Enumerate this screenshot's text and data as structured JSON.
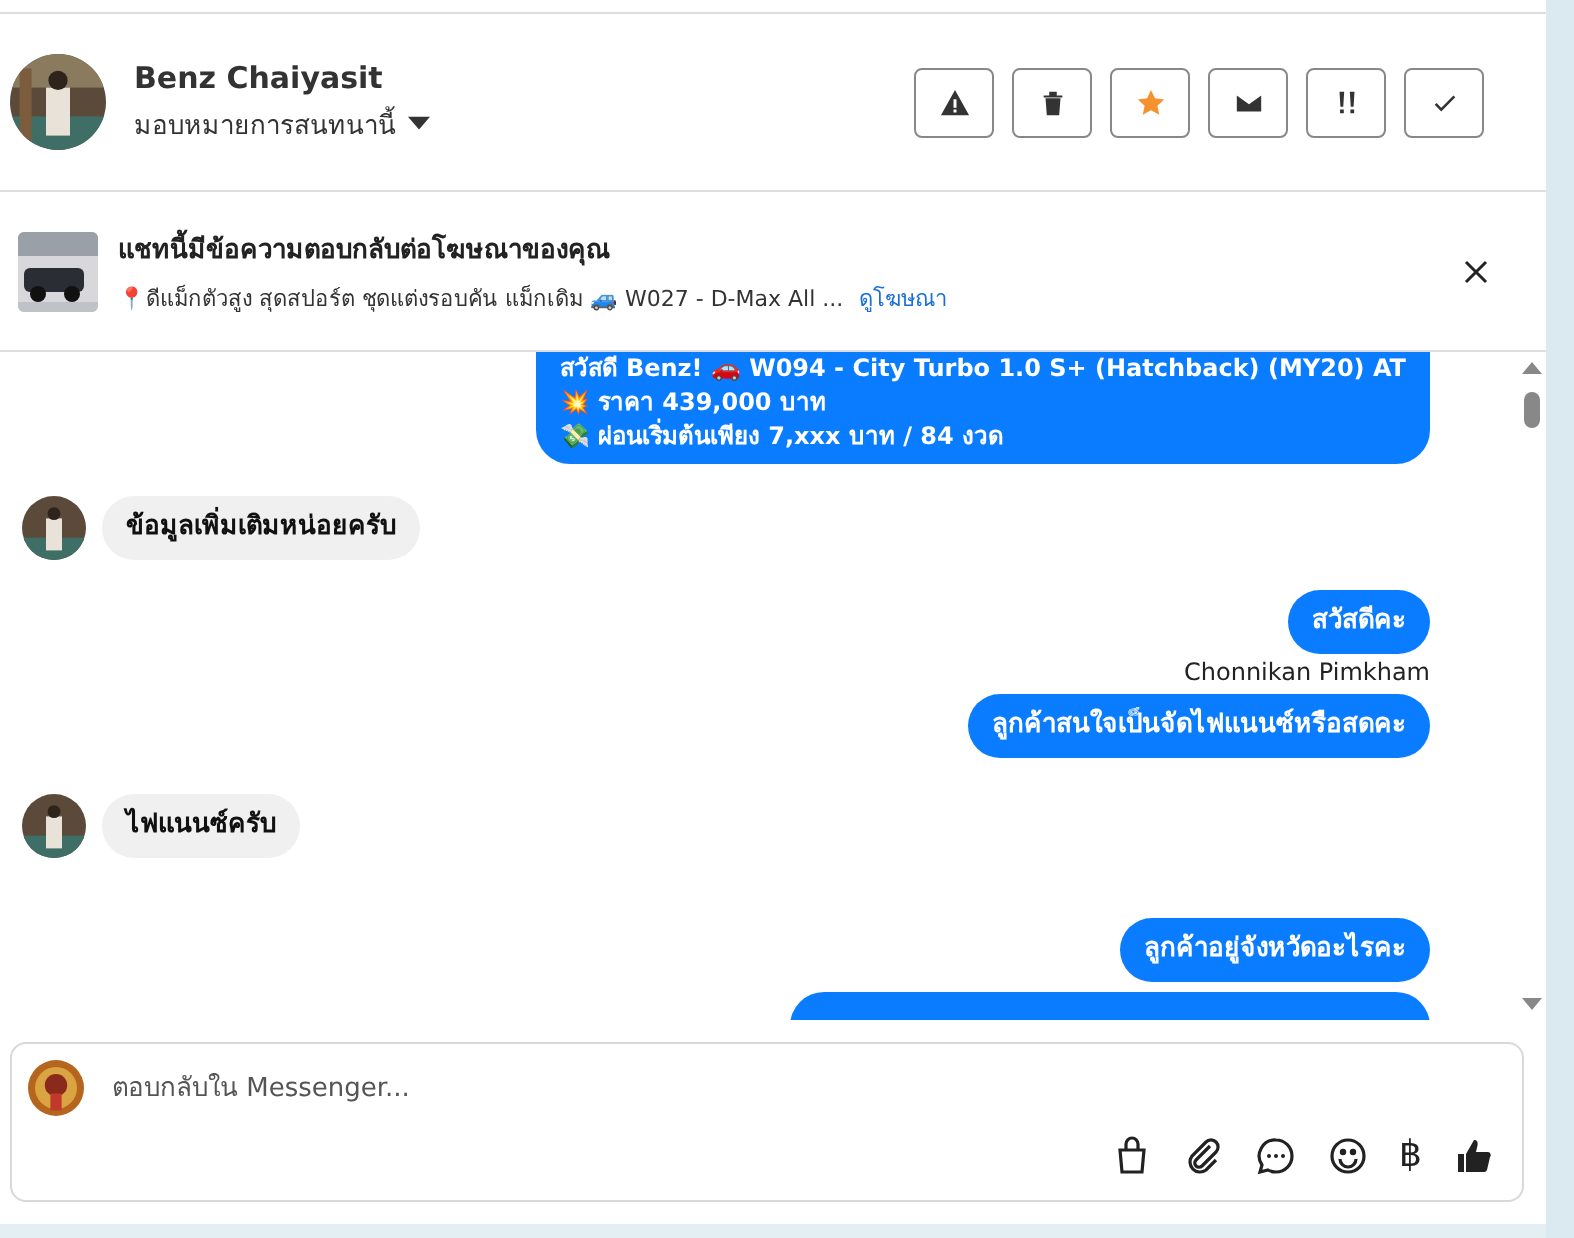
{
  "header": {
    "name": "Benz Chaiyasit",
    "assign": "มอบหมายการสนทนานี้",
    "actions": [
      {
        "kind": "warning",
        "active": false
      },
      {
        "kind": "trash",
        "active": false
      },
      {
        "kind": "star",
        "active": true
      },
      {
        "kind": "mail",
        "active": false
      },
      {
        "kind": "priority",
        "active": false
      },
      {
        "kind": "check",
        "active": false
      }
    ]
  },
  "banner": {
    "title": "แชทนี้มีข้อความตอบกลับต่อโฆษณาของคุณ",
    "text": "📍ดีแม็กตัวสูง สุดสปอร์ต ชุดแต่งรอบคัน แม็กเดิม 🚙 W027 - D-Max All ...",
    "link": "ดูโฆษณา"
  },
  "messages": [
    {
      "kind": "sent",
      "lines": [
        "สวัสดี Benz! 🚗 W094 - City Turbo 1.0 S+ (Hatchback) (MY20) AT",
        "💥 ราคา 439,000 บาท",
        "💸 ผ่อนเริ่มต้นเพียง 7,xxx บาท / 84 งวด"
      ]
    },
    {
      "kind": "received",
      "lines": [
        "ข้อมูลเพิ่มเติมหน่อยครับ"
      ]
    },
    {
      "kind": "sent",
      "lines": [
        "สวัสดีคะ"
      ]
    },
    {
      "kind": "sender",
      "lines": [
        "Chonnikan Pimkham"
      ]
    },
    {
      "kind": "sent",
      "lines": [
        "ลูกค้าสนใจเป็นจัดไฟแนนซ์หรือสดคะ"
      ]
    },
    {
      "kind": "received",
      "lines": [
        "ไฟแนนซ์ครับ"
      ]
    },
    {
      "kind": "sent",
      "lines": [
        "ลูกค้าอยู่จังหวัดอะไรคะ"
      ]
    },
    {
      "kind": "sent"
    }
  ],
  "composer": {
    "placeholder": "ตอบกลับใน Messenger...",
    "tools": [
      {
        "kind": "bag"
      },
      {
        "kind": "clip"
      },
      {
        "kind": "chat"
      },
      {
        "kind": "smile"
      },
      {
        "kind": "baht",
        "label": "฿"
      },
      {
        "kind": "like"
      }
    ]
  }
}
